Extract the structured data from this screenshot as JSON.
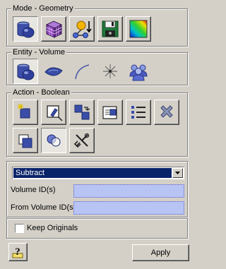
{
  "mode_group": {
    "title": "Mode - Geometry",
    "buttons": [
      {
        "icon": "volume-cylinder-icon",
        "state": "pressed"
      },
      {
        "icon": "mesh-cube-icon",
        "state": "raised"
      },
      {
        "icon": "boundary-conditions-icon",
        "state": "raised"
      },
      {
        "icon": "save-disk-icon",
        "state": "raised"
      },
      {
        "icon": "contour-gradient-icon",
        "state": "raised"
      }
    ]
  },
  "entity_group": {
    "title": "Entity - Volume",
    "buttons": [
      {
        "icon": "volume-entity-icon",
        "state": "pressed"
      },
      {
        "icon": "surface-entity-icon",
        "state": "flat"
      },
      {
        "icon": "curve-entity-icon",
        "state": "flat"
      },
      {
        "icon": "vertex-entity-icon",
        "state": "flat"
      },
      {
        "icon": "group-entity-icon",
        "state": "flat"
      }
    ]
  },
  "action_group": {
    "title": "Action - Boolean",
    "buttons": [
      {
        "icon": "create-icon",
        "state": "raised"
      },
      {
        "icon": "modify-icon",
        "state": "raised"
      },
      {
        "icon": "transform-icon",
        "state": "raised"
      },
      {
        "icon": "properties-icon",
        "state": "raised"
      },
      {
        "icon": "list-icon",
        "state": "raised"
      },
      {
        "icon": "delete-icon",
        "state": "raised"
      },
      {
        "icon": "copy-icon",
        "state": "raised"
      },
      {
        "icon": "boolean-icon",
        "state": "pressed"
      },
      {
        "icon": "decompose-icon",
        "state": "raised"
      }
    ]
  },
  "form": {
    "operation": "Subtract",
    "volume_ids_label": "Volume ID(s)",
    "volume_ids_value": "",
    "from_volume_ids_label": "From Volume ID(s)",
    "from_volume_ids_value": "",
    "keep_originals_label": "Keep Originals",
    "keep_originals_checked": false
  },
  "footer": {
    "help_icon": "help-icon",
    "apply_label": "Apply"
  },
  "colors": {
    "panel": "#d4d0c8",
    "selection": "#0a246a",
    "field": "#b8c4f4"
  }
}
